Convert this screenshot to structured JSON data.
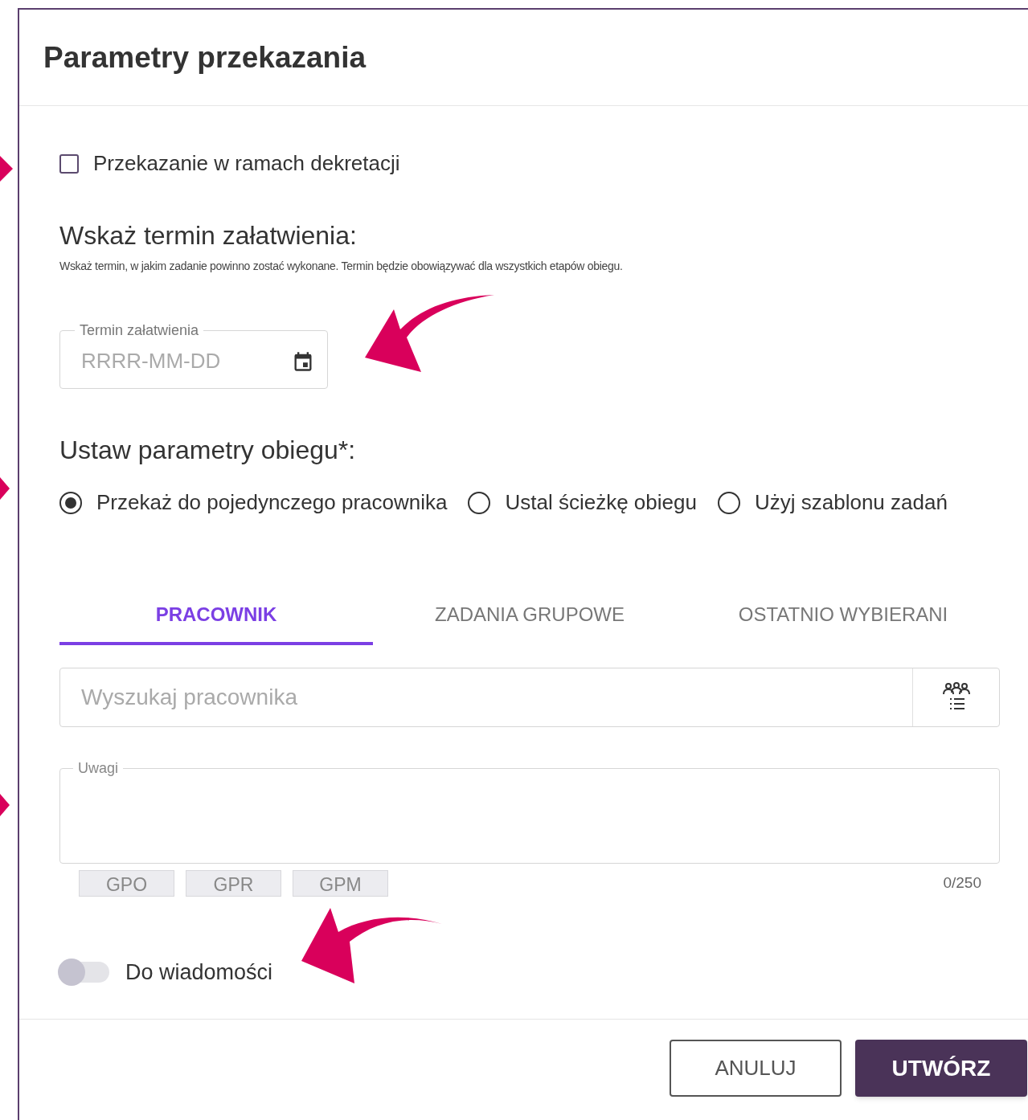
{
  "dialog": {
    "title": "Parametry przekazania"
  },
  "checkbox": {
    "label": "Przekazanie w ramach dekretacji",
    "checked": false
  },
  "deadline": {
    "heading": "Wskaż termin załatwienia:",
    "description": "Wskaż termin, w jakim zadanie powinno zostać wykonane. Termin będzie obowiązywać dla wszystkich etapów obiegu.",
    "field": {
      "label": "Termin załatwienia",
      "placeholder": "RRRR-MM-DD"
    }
  },
  "circulation": {
    "heading": "Ustaw parametry obiegu*:",
    "options": [
      {
        "label": "Przekaż do pojedynczego pracownika",
        "selected": true
      },
      {
        "label": "Ustal ścieżkę obiegu",
        "selected": false
      },
      {
        "label": "Użyj szablonu zadań",
        "selected": false
      }
    ]
  },
  "tabs": [
    {
      "label": "PRACOWNIK",
      "selected": true
    },
    {
      "label": "ZADANIA GRUPOWE",
      "selected": false
    },
    {
      "label": "OSTATNIO WYBIERANI",
      "selected": false
    }
  ],
  "search": {
    "placeholder": "Wyszukaj pracownika"
  },
  "notes": {
    "label": "Uwagi",
    "chips": [
      "GPO",
      "GPR",
      "GPM"
    ],
    "counter": "0/250"
  },
  "toggle": {
    "label": "Do wiadomości",
    "on": false
  },
  "buttons": [
    {
      "label": "ANULUJ",
      "kind": "outline"
    },
    {
      "label": "UTWÓRZ",
      "kind": "primary"
    }
  ]
}
